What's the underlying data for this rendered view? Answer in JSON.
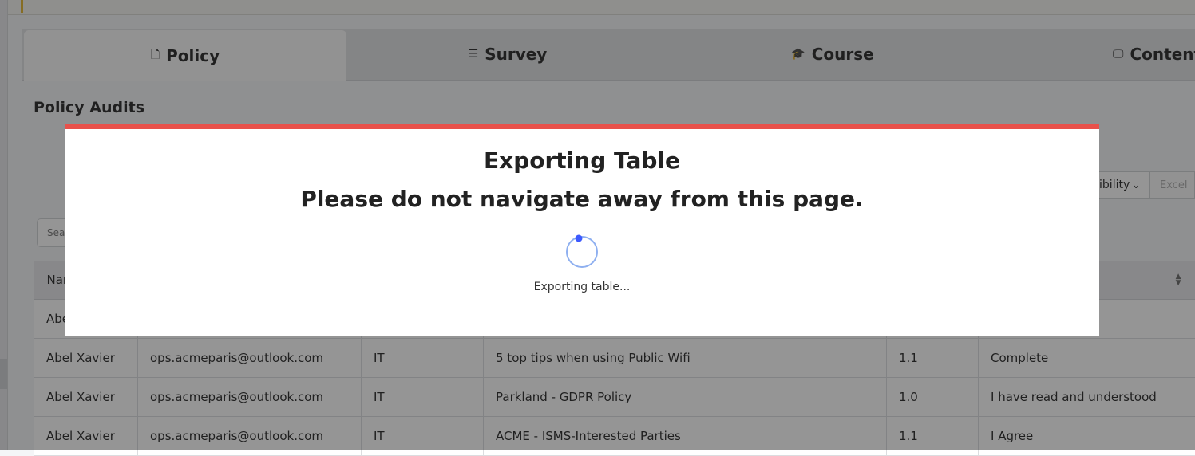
{
  "tabs": [
    {
      "label": "Policy",
      "icon": "file-icon",
      "active": true
    },
    {
      "label": "Survey",
      "icon": "list-icon",
      "active": false
    },
    {
      "label": "Course",
      "icon": "graduation-cap-icon",
      "active": false
    },
    {
      "label": "Content",
      "icon": "monitor-icon",
      "active": false
    }
  ],
  "page": {
    "title": "Policy Audits",
    "search_placeholder": "Search",
    "visibility_label": "Column Visibility",
    "export_label": "Excel"
  },
  "table": {
    "header": {
      "name": "Name"
    },
    "rows": [
      {
        "name": "Abel Xavier",
        "email": "",
        "department": "",
        "policy": "",
        "version": "",
        "status": ""
      },
      {
        "name": "Abel Xavier",
        "email": "ops.acmeparis@outlook.com",
        "department": "IT",
        "policy": "5 top tips when using Public Wifi",
        "version": "1.1",
        "status": "Complete"
      },
      {
        "name": "Abel Xavier",
        "email": "ops.acmeparis@outlook.com",
        "department": "IT",
        "policy": "Parkland - GDPR Policy",
        "version": "1.0",
        "status": "I have read and understood"
      },
      {
        "name": "Abel Xavier",
        "email": "ops.acmeparis@outlook.com",
        "department": "IT",
        "policy": "ACME - ISMS-Interested Parties",
        "version": "1.1",
        "status": "I Agree"
      }
    ]
  },
  "modal": {
    "title": "Exporting Table",
    "subtitle": "Please do not navigate away from this page.",
    "message": "Exporting table...",
    "accent_color": "#e8514b",
    "spinner_color": "#3d5afe"
  }
}
